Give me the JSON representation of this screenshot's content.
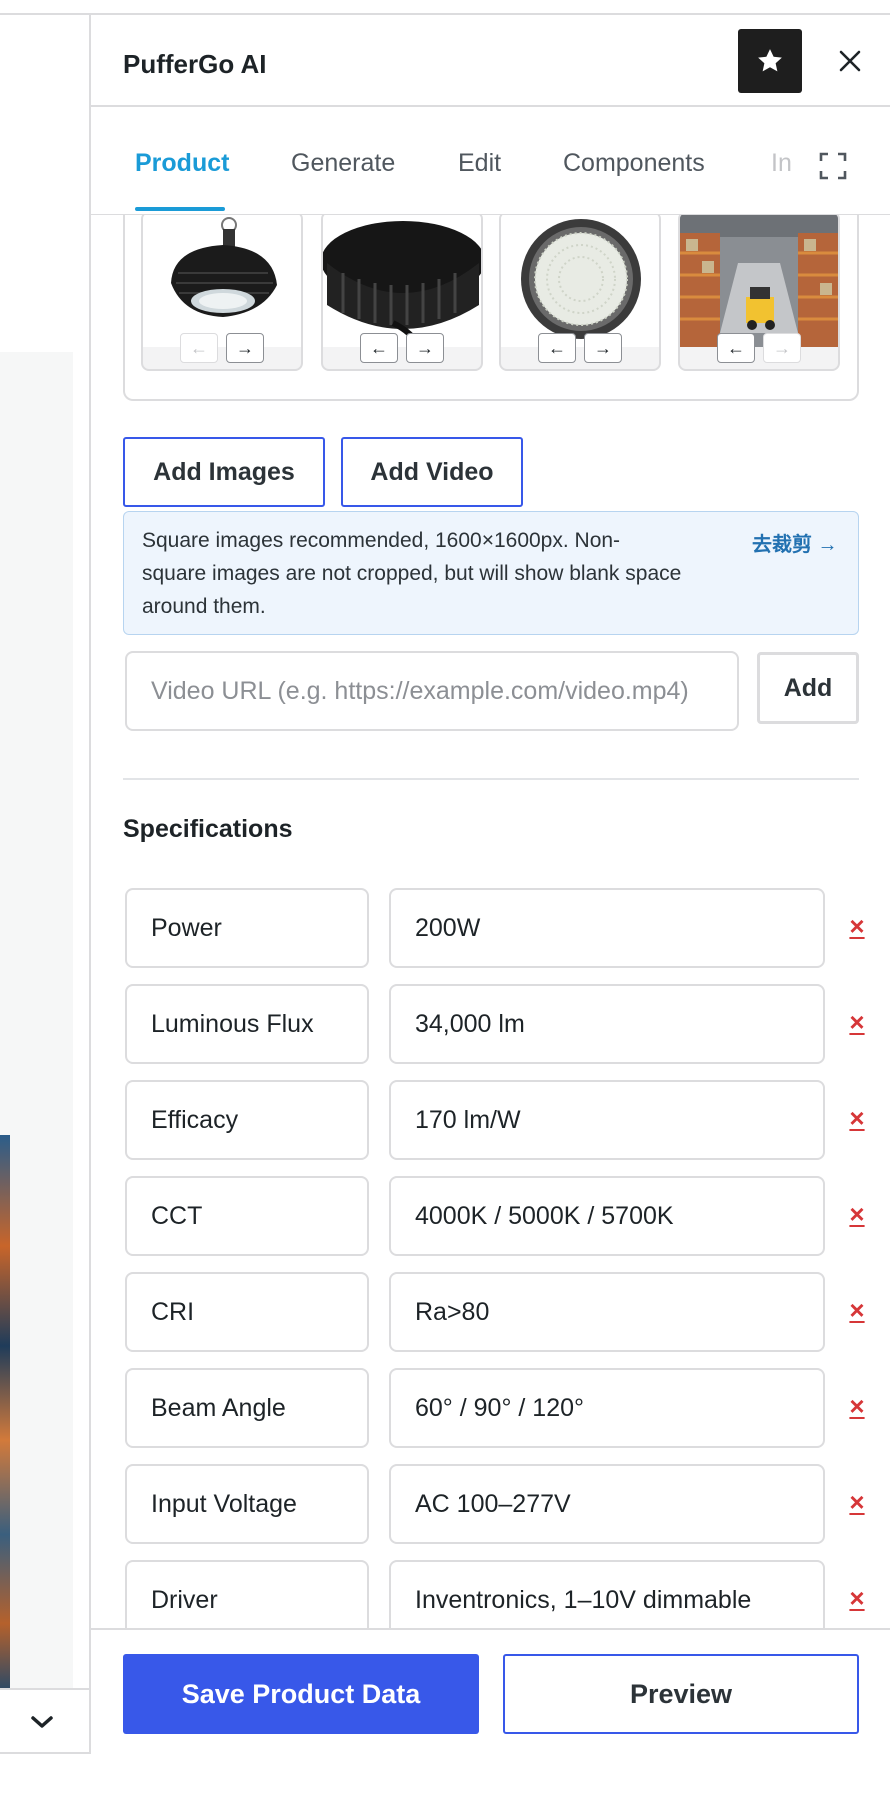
{
  "panel": {
    "title": "PufferGo AI",
    "star_icon": "star-icon",
    "close_icon": "close-icon"
  },
  "tabs": [
    {
      "label": "Product",
      "active": true
    },
    {
      "label": "Generate",
      "active": false
    },
    {
      "label": "Edit",
      "active": false
    },
    {
      "label": "Components",
      "active": false
    },
    {
      "label": "In",
      "active": false
    }
  ],
  "gallery": {
    "thumbnails": [
      {
        "subject": "high bay light side view",
        "prev": "←",
        "next": "→",
        "prev_disabled": true,
        "next_disabled": false
      },
      {
        "subject": "high bay light heatsink",
        "prev": "←",
        "next": "→",
        "prev_disabled": false,
        "next_disabled": false
      },
      {
        "subject": "high bay light LED face",
        "prev": "←",
        "next": "→",
        "prev_disabled": false,
        "next_disabled": false
      },
      {
        "subject": "warehouse with forklift",
        "prev": "←",
        "next": "→",
        "prev_disabled": false,
        "next_disabled": true
      }
    ]
  },
  "media": {
    "add_images_label": "Add Images",
    "add_video_label": "Add Video",
    "notice_text": "Square images recommended, 1600×1600px. Non-square images are not cropped, but will show blank space around them.",
    "crop_link": "去裁剪 →",
    "video_url_placeholder": "Video URL (e.g. https://example.com/video.mp4)",
    "video_url_value": "",
    "add_label": "Add"
  },
  "specifications": {
    "title": "Specifications",
    "delete_symbol": "×",
    "rows": [
      {
        "key": "Power",
        "value": "200W"
      },
      {
        "key": "Luminous Flux",
        "value": "34,000 lm"
      },
      {
        "key": "Efficacy",
        "value": "170 lm/W"
      },
      {
        "key": "CCT",
        "value": "4000K / 5000K / 5700K"
      },
      {
        "key": "CRI",
        "value": "Ra>80"
      },
      {
        "key": "Beam Angle",
        "value": "60° / 90° / 120°"
      },
      {
        "key": "Input Voltage",
        "value": "AC 100–277V"
      },
      {
        "key": "Driver",
        "value": "Inventronics, 1–10V dimmable"
      }
    ]
  },
  "footer": {
    "save_label": "Save Product Data",
    "preview_label": "Preview"
  },
  "colors": {
    "accent_blue": "#3858e9",
    "tab_active": "#1a9bd7",
    "delete_red": "#d63638",
    "notice_bg": "#eef5fd"
  }
}
